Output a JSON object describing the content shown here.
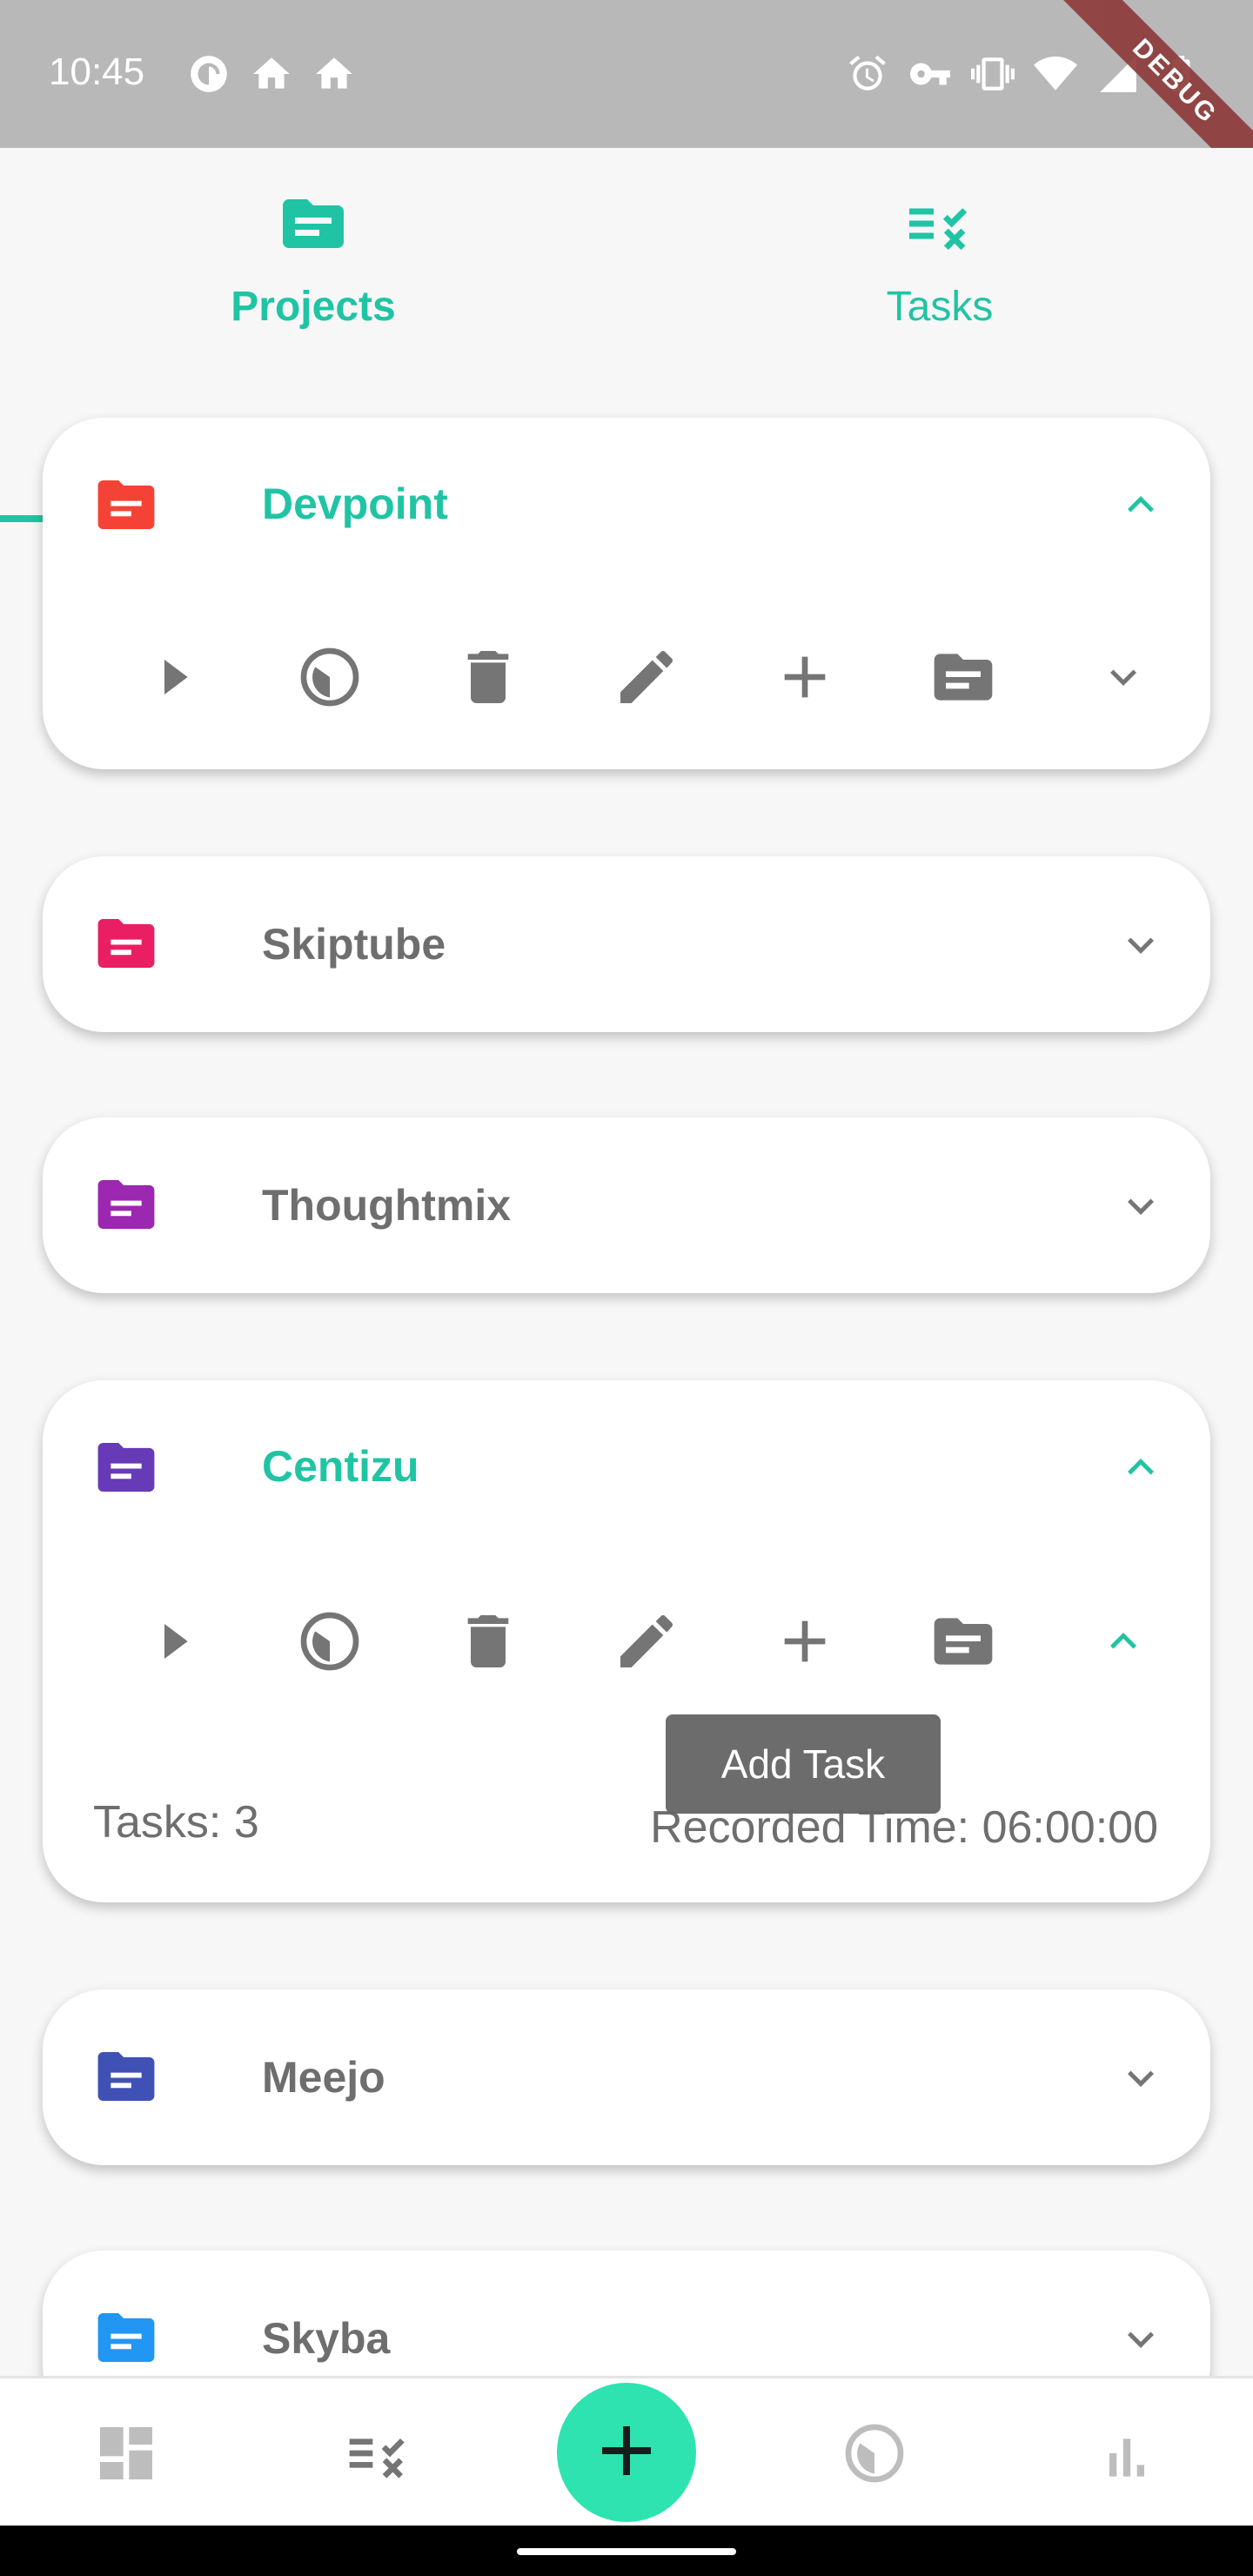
{
  "status_bar": {
    "time": "10:45",
    "left_icons": [
      "pocket-casts-icon",
      "home-icon",
      "home-icon"
    ],
    "right_icons": [
      "alarm-icon",
      "vpn-key-icon",
      "vibrate-icon",
      "wifi-icon",
      "signal-icon",
      "battery-charging-icon"
    ]
  },
  "debug_banner": "DEBUG",
  "tabs": [
    {
      "label": "Projects",
      "icon": "folder-icon",
      "active": true
    },
    {
      "label": "Tasks",
      "icon": "checklist-icon",
      "active": false
    }
  ],
  "colors": {
    "accent": "#20c4a4",
    "fab": "#2ee3b0",
    "text_secondary": "#6e6e6e"
  },
  "projects": [
    {
      "name": "Devpoint",
      "color": "#f44336",
      "expanded": true
    },
    {
      "name": "Skiptube",
      "color": "#e91e63",
      "expanded": false
    },
    {
      "name": "Thoughtmix",
      "color": "#9c27b0",
      "expanded": false
    },
    {
      "name": "Centizu",
      "color": "#673ab7",
      "expanded": true,
      "tasks_label": "Tasks: 3",
      "recorded_label": "Recorded Time: 06:00:00"
    },
    {
      "name": "Meejo",
      "color": "#3f51b5",
      "expanded": false
    },
    {
      "name": "Skyba",
      "color": "#2196f3",
      "expanded": false
    }
  ],
  "project_actions": [
    "play-icon",
    "timer-icon",
    "delete-icon",
    "edit-icon",
    "add-icon",
    "folder-icon",
    "chevron-icon"
  ],
  "tooltip": "Add Task",
  "bottom_nav": [
    "dashboard-icon",
    "checklist-icon",
    "add-icon",
    "timer-icon",
    "stats-icon"
  ]
}
